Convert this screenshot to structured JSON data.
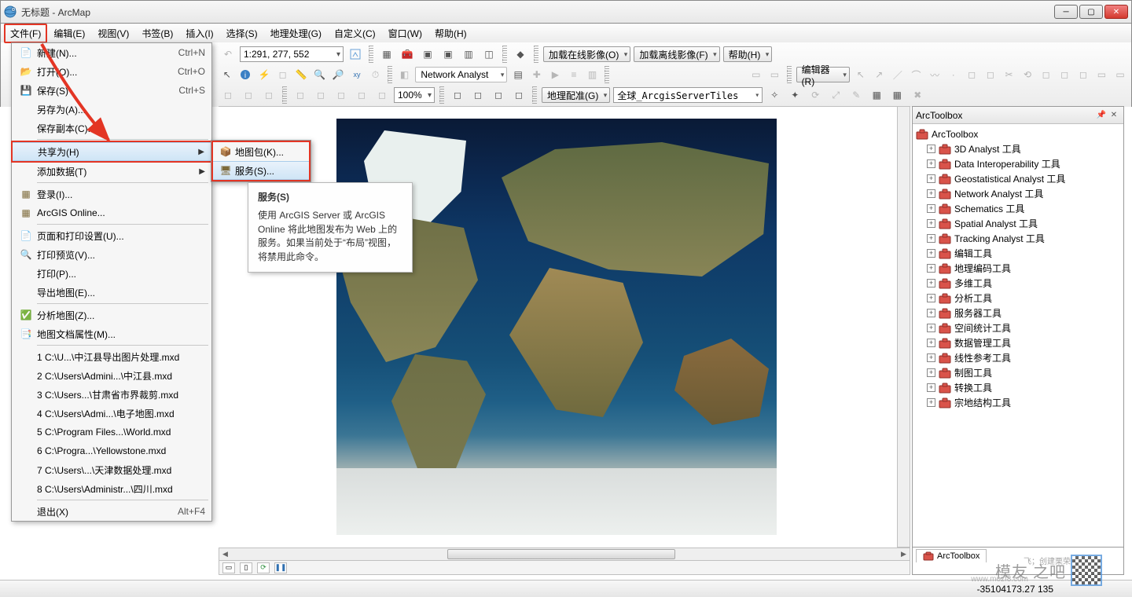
{
  "window": {
    "title": "无标题 - ArcMap"
  },
  "menubar": [
    "文件(F)",
    "编辑(E)",
    "视图(V)",
    "书签(B)",
    "插入(I)",
    "选择(S)",
    "地理处理(G)",
    "自定义(C)",
    "窗口(W)",
    "帮助(H)"
  ],
  "file_menu": {
    "items": [
      {
        "label": "新建(N)...",
        "short": "Ctrl+N",
        "icon": "doc"
      },
      {
        "label": "打开(O)...",
        "short": "Ctrl+O",
        "icon": "open"
      },
      {
        "label": "保存(S)",
        "short": "Ctrl+S",
        "icon": "save"
      },
      {
        "label": "另存为(A)...",
        "short": "",
        "icon": ""
      },
      {
        "label": "保存副本(C)...",
        "short": "",
        "icon": ""
      },
      {
        "label": "共享为(H)",
        "short": "",
        "icon": "",
        "sub": true,
        "hl": true,
        "redbox": true
      },
      {
        "label": "添加数据(T)",
        "short": "",
        "icon": "",
        "sub": true
      },
      {
        "label": "登录(I)...",
        "short": "",
        "icon": "grid"
      },
      {
        "label": "ArcGIS Online...",
        "short": "",
        "icon": "grid"
      },
      {
        "label": "页面和打印设置(U)...",
        "short": "",
        "icon": "page"
      },
      {
        "label": "打印预览(V)...",
        "short": "",
        "icon": "preview"
      },
      {
        "label": "打印(P)...",
        "short": "",
        "icon": ""
      },
      {
        "label": "导出地图(E)...",
        "short": "",
        "icon": ""
      },
      {
        "label": "分析地图(Z)...",
        "short": "",
        "icon": "check"
      },
      {
        "label": "地图文档属性(M)...",
        "short": "",
        "icon": "prop"
      },
      {
        "label": "1 C:\\U...\\中江县导出图片处理.mxd",
        "short": "",
        "recent": true
      },
      {
        "label": "2 C:\\Users\\Admini...\\中江县.mxd",
        "short": "",
        "recent": true
      },
      {
        "label": "3 C:\\Users...\\甘肃省市界裁剪.mxd",
        "short": "",
        "recent": true
      },
      {
        "label": "4 C:\\Users\\Admi...\\电子地图.mxd",
        "short": "",
        "recent": true
      },
      {
        "label": "5 C:\\Program Files...\\World.mxd",
        "short": "",
        "recent": true
      },
      {
        "label": "6 C:\\Progra...\\Yellowstone.mxd",
        "short": "",
        "recent": true
      },
      {
        "label": "7 C:\\Users\\...\\天津数据处理.mxd",
        "short": "",
        "recent": true
      },
      {
        "label": "8 C:\\Users\\Administr...\\四川.mxd",
        "short": "",
        "recent": true
      },
      {
        "label": "退出(X)",
        "short": "Alt+F4"
      }
    ]
  },
  "share_submenu": [
    {
      "label": "地图包(K)...",
      "icon": "pkg"
    },
    {
      "label": "服务(S)...",
      "icon": "svc",
      "hl": true
    }
  ],
  "tooltip": {
    "title": "服务(S)",
    "body": "使用 ArcGIS Server 或 ArcGIS Online 将此地图发布为 Web 上的服务。如果当前处于“布局”视图，将禁用此命令。"
  },
  "toolbars": {
    "scale": "1:291, 277, 552",
    "row1_drops": [
      "加载在线影像(O)",
      "加载离线影像(F)",
      "帮助(H)"
    ],
    "network_label": "Network Analyst",
    "editor_label": "编辑器(R)",
    "zoom_pct": "100%",
    "georef_label": "地理配准(G)",
    "georef_layer": "全球_ArcgisServerTiles"
  },
  "toolbox": {
    "title": "ArcToolbox",
    "root": "ArcToolbox",
    "items": [
      "3D Analyst 工具",
      "Data Interoperability 工具",
      "Geostatistical Analyst 工具",
      "Network Analyst 工具",
      "Schematics 工具",
      "Spatial Analyst 工具",
      "Tracking Analyst 工具",
      "编辑工具",
      "地理编码工具",
      "多维工具",
      "分析工具",
      "服务器工具",
      "空间统计工具",
      "数据管理工具",
      "线性参考工具",
      "制图工具",
      "转换工具",
      "宗地结构工具"
    ],
    "tab_label": "ArcToolbox"
  },
  "status": {
    "coords": "-35104173.27  135"
  },
  "watermark": {
    "main": "模友    之吧",
    "sub": "www.mozf8.com",
    "small": "飞；创建栗荣"
  }
}
